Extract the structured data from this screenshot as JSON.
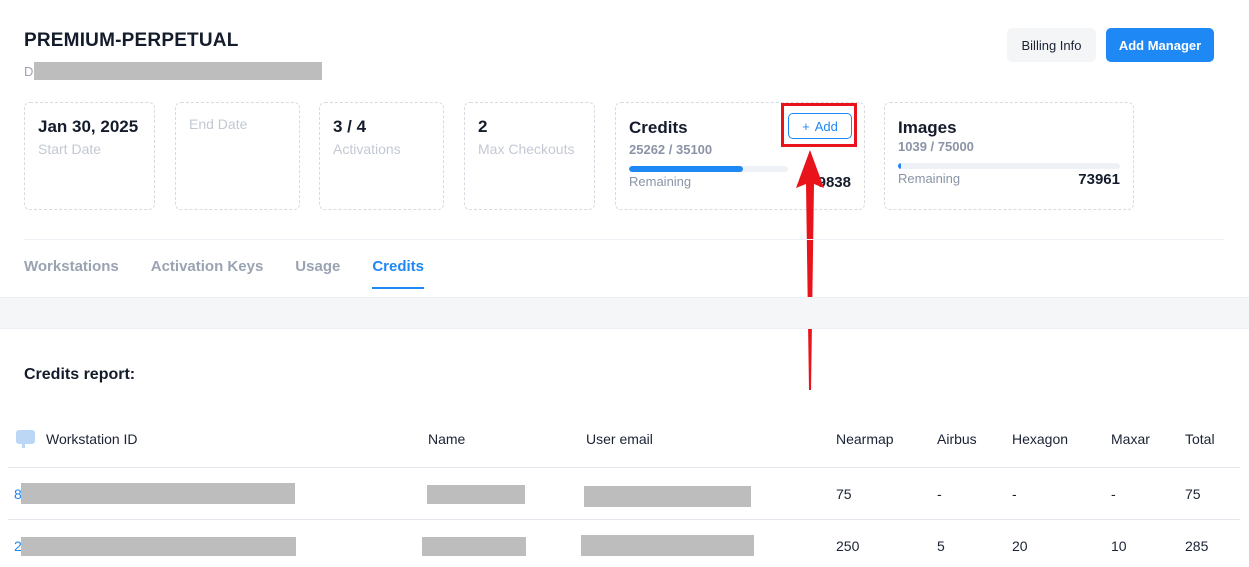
{
  "header": {
    "plan_name": "PREMIUM-PERPETUAL",
    "plan_sub_letter": "D",
    "billing_label": "Billing Info",
    "add_manager_label": "Add Manager"
  },
  "cards": {
    "start": {
      "value": "Jan 30, 2025",
      "label": "Start Date"
    },
    "end": {
      "label": "End Date"
    },
    "activations": {
      "value": "3 / 4",
      "label": "Activations"
    },
    "checkouts": {
      "value": "2",
      "label": "Max Checkouts"
    },
    "credits": {
      "title": "Credits",
      "ratio": "25262 / 35100",
      "remaining_label": "Remaining",
      "remaining_value": "9838",
      "add_label": "Add",
      "add_icon": "plus-icon",
      "progress": 0.72
    },
    "images": {
      "title": "Images",
      "ratio": "1039 / 75000",
      "remaining_label": "Remaining",
      "remaining_value": "73961",
      "progress": 0.014
    }
  },
  "tabs": [
    {
      "label": "Workstations",
      "active": false
    },
    {
      "label": "Activation Keys",
      "active": false
    },
    {
      "label": "Usage",
      "active": false
    },
    {
      "label": "Credits",
      "active": true
    }
  ],
  "report": {
    "title": "Credits report:",
    "columns": [
      "Workstation ID",
      "Name",
      "User email",
      "Nearmap",
      "Airbus",
      "Hexagon",
      "Maxar",
      "Total"
    ],
    "rows": [
      {
        "id_prefix": "8",
        "nearmap": "75",
        "airbus": "-",
        "hexagon": "-",
        "maxar": "-",
        "total": "75"
      },
      {
        "id_prefix": "2",
        "nearmap": "250",
        "airbus": "5",
        "hexagon": "20",
        "maxar": "10",
        "total": "285"
      }
    ]
  },
  "colors": {
    "accent": "#1e88f5",
    "highlight": "#e8131b",
    "redacted": "#bdbdbd"
  }
}
